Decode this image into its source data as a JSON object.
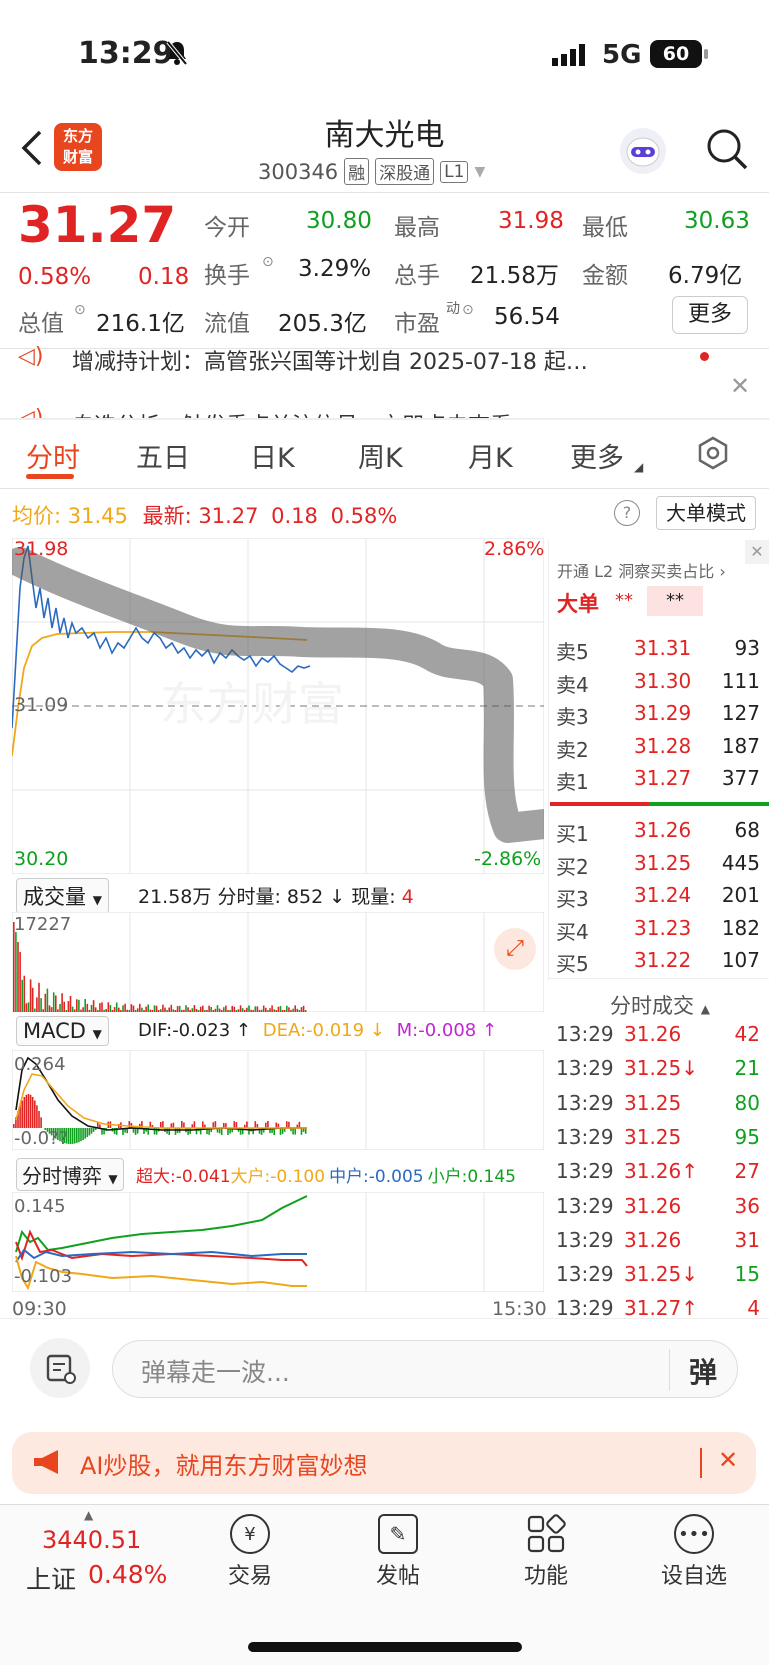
{
  "status_bar": {
    "time": "13:29",
    "network": "5G",
    "battery": "60"
  },
  "header": {
    "logo_line1": "东方",
    "logo_line2": "财富",
    "title": "南大光电",
    "code": "300346",
    "tags": [
      "融",
      "深股通",
      "L1"
    ]
  },
  "quote": {
    "price": "31.27",
    "pct": "0.58%",
    "change": "0.18",
    "open_label": "今开",
    "open": "30.80",
    "high_label": "最高",
    "high": "31.98",
    "low_label": "最低",
    "low": "30.63",
    "turnover_label": "换手",
    "turnover": "3.29%",
    "volume_label": "总手",
    "volume": "21.58万",
    "amount_label": "金额",
    "amount": "6.79亿",
    "mktcap_label": "总值",
    "mktcap": "216.1亿",
    "float_label": "流值",
    "float": "205.3亿",
    "pe_label": "市盈",
    "pe_sup": "动",
    "pe": "56.54",
    "more": "更多"
  },
  "notices": {
    "line1": "增减持计划：高管张兴国等计划自 2025-07-18 起…",
    "line2": "自选分析：触发重点关注信号，亦即点击查看"
  },
  "tabs": [
    "分时",
    "五日",
    "日K",
    "周K",
    "月K",
    "更多"
  ],
  "info": {
    "avg_label": "均价:",
    "avg": "31.45",
    "latest_label": "最新:",
    "latest": "31.27",
    "latest_chg": "0.18",
    "latest_pct": "0.58%",
    "mode_btn": "大单模式"
  },
  "chart_axis": {
    "top_price": "31.98",
    "top_pct": "2.86%",
    "mid_price": "31.09",
    "bottom_price": "30.20",
    "bottom_pct": "-2.86%",
    "watermark": "东方财富",
    "time_start": "09:30",
    "time_end": "15:30"
  },
  "volume_panel": {
    "selector": "成交量",
    "total": "21.58万",
    "tick_label": "分时量:",
    "tick": "852",
    "now_label": "现量:",
    "now": "4",
    "max": "17227"
  },
  "macd_panel": {
    "selector": "MACD",
    "dif": "DIF:-0.023 ↑",
    "dea": "DEA:-0.019 ↓",
    "m": "M:-0.008 ↑",
    "top": "0.264",
    "bottom": "-0.0??"
  },
  "game_panel": {
    "selector": "分时博弈",
    "super": "超大:-0.041",
    "big": "大户:-0.100",
    "mid": "中户:-0.005",
    "small": "小户:0.145",
    "top": "0.145",
    "bottom": "-0.103"
  },
  "orderbook": {
    "promo": "开通 L2 洞察买卖占比",
    "big_label": "大单",
    "stars1": "**",
    "stars2": "**",
    "asks": [
      {
        "label": "卖5",
        "price": "31.31",
        "vol": "93"
      },
      {
        "label": "卖4",
        "price": "31.30",
        "vol": "111"
      },
      {
        "label": "卖3",
        "price": "31.29",
        "vol": "127"
      },
      {
        "label": "卖2",
        "price": "31.28",
        "vol": "187"
      },
      {
        "label": "卖1",
        "price": "31.27",
        "vol": "377"
      }
    ],
    "bids": [
      {
        "label": "买1",
        "price": "31.26",
        "vol": "68"
      },
      {
        "label": "买2",
        "price": "31.25",
        "vol": "445"
      },
      {
        "label": "买3",
        "price": "31.24",
        "vol": "201"
      },
      {
        "label": "买4",
        "price": "31.23",
        "vol": "182"
      },
      {
        "label": "买5",
        "price": "31.22",
        "vol": "107"
      }
    ]
  },
  "trades": {
    "title": "分时成交",
    "rows": [
      {
        "time": "13:29",
        "price": "31.26",
        "vol": "42",
        "pc": "red",
        "vc": "red"
      },
      {
        "time": "13:29",
        "price": "31.25↓",
        "vol": "21",
        "pc": "red",
        "vc": "green"
      },
      {
        "time": "13:29",
        "price": "31.25",
        "vol": "80",
        "pc": "red",
        "vc": "green"
      },
      {
        "time": "13:29",
        "price": "31.25",
        "vol": "95",
        "pc": "red",
        "vc": "green"
      },
      {
        "time": "13:29",
        "price": "31.26↑",
        "vol": "27",
        "pc": "red",
        "vc": "red"
      },
      {
        "time": "13:29",
        "price": "31.26",
        "vol": "36",
        "pc": "red",
        "vc": "red"
      },
      {
        "time": "13:29",
        "price": "31.26",
        "vol": "31",
        "pc": "red",
        "vc": "red"
      },
      {
        "time": "13:29",
        "price": "31.25↓",
        "vol": "15",
        "pc": "red",
        "vc": "green"
      },
      {
        "time": "13:29",
        "price": "31.27↑",
        "vol": "4",
        "pc": "red",
        "vc": "red"
      }
    ]
  },
  "comment_bar": {
    "placeholder": "弹幕走一波...",
    "danmu_btn": "弹"
  },
  "ai_banner": {
    "text": "AI炒股，就用东方财富妙想"
  },
  "bottom_nav": {
    "index_value": "3440.51",
    "index_name": "上证",
    "index_pct": "0.48%",
    "items": [
      "交易",
      "发帖",
      "功能",
      "设自选"
    ]
  },
  "colors": {
    "up": "#e02424",
    "down": "#10a020",
    "accent": "#e8461f",
    "avg_line": "#f0a818",
    "price_line": "#2b6ac0"
  }
}
